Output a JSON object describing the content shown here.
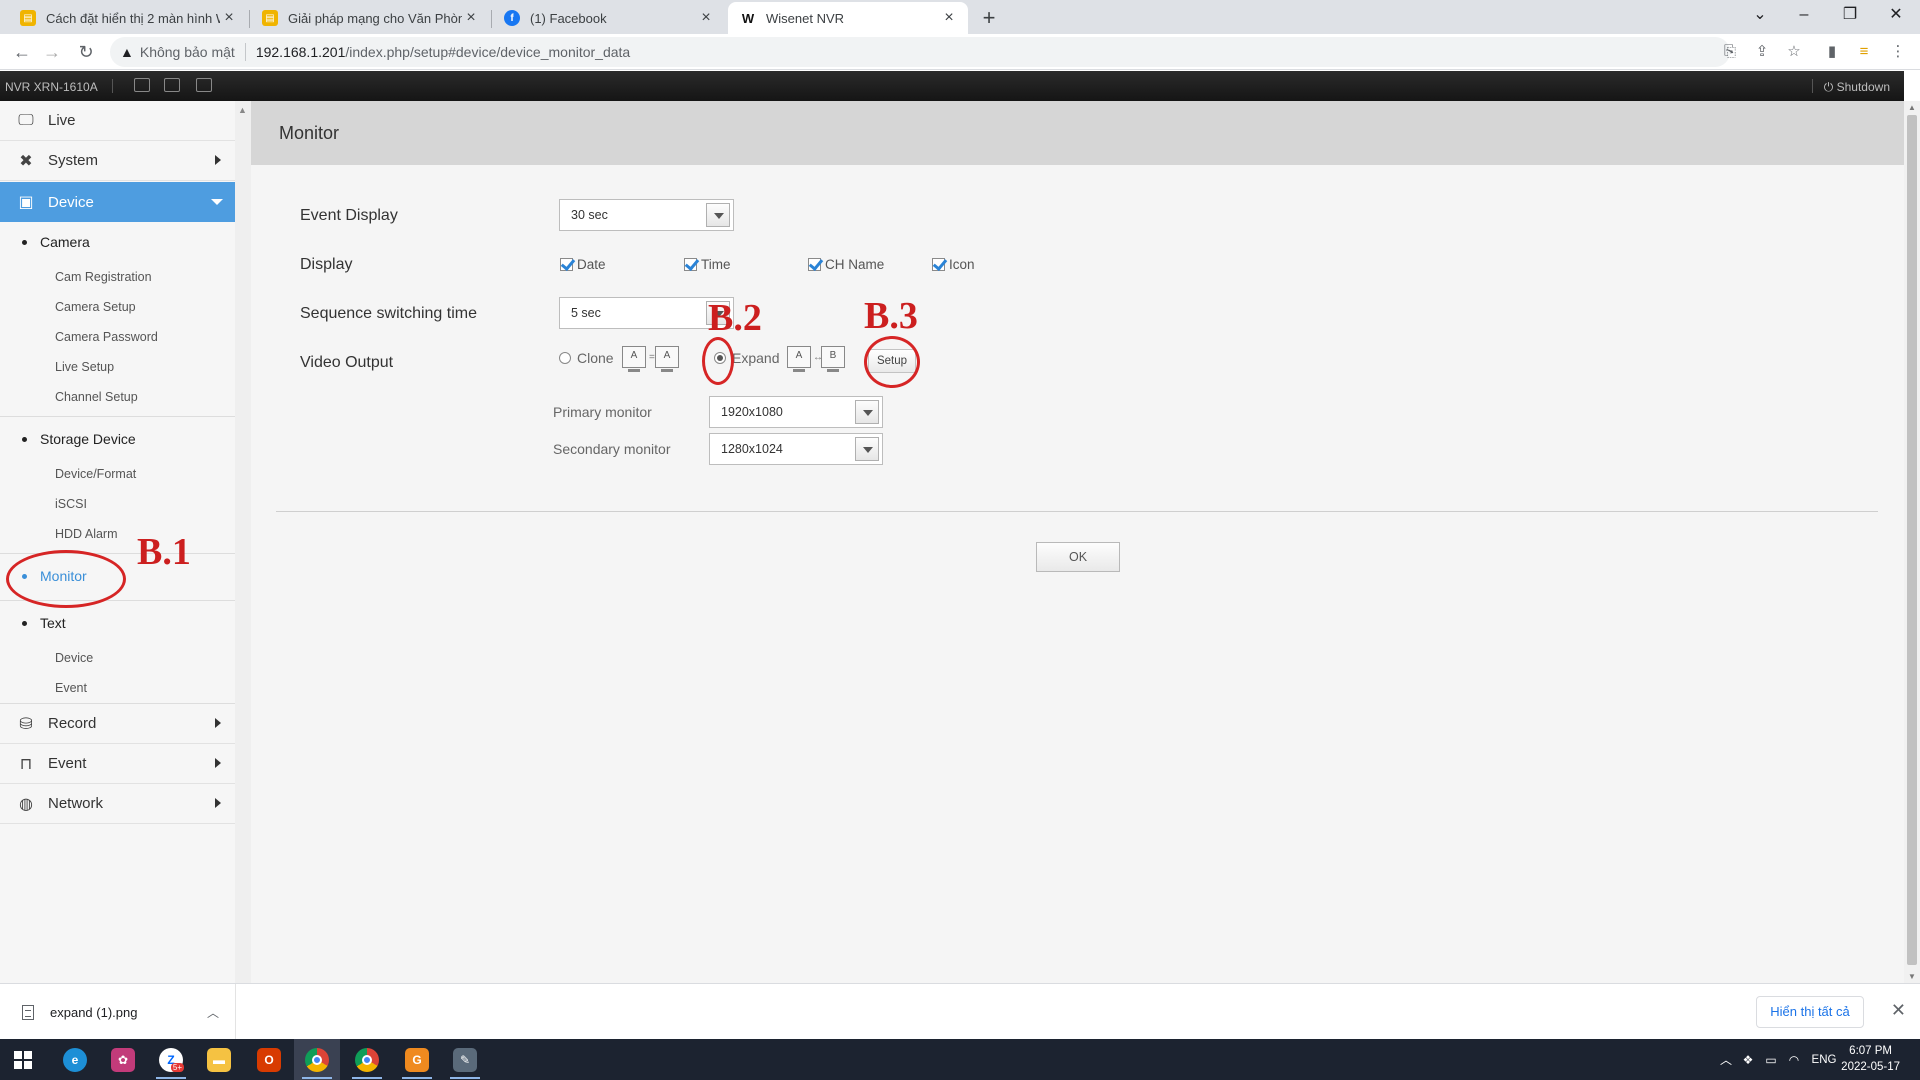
{
  "browser": {
    "tabs": [
      {
        "title": "Cách đặt hiển thị 2 màn hình Wis",
        "favicon": "folder-favicon-icon"
      },
      {
        "title": "Giải pháp mạng cho Văn Phòng,",
        "favicon": "folder-favicon-icon"
      },
      {
        "title": "(1) Facebook",
        "favicon": "facebook-icon"
      },
      {
        "title": "Wisenet NVR",
        "favicon": "wisenet-icon",
        "favicon_text": "W"
      }
    ],
    "address": {
      "security_label": "Không bảo mật",
      "host": "192.168.1.201",
      "path": "/index.php/setup#device/device_monitor_data"
    }
  },
  "nvr": {
    "model": "NVR XRN-1610A",
    "shutdown_label": "Shutdown"
  },
  "sidebar": {
    "menu": [
      {
        "label": "Live",
        "icon": "monitor-icon"
      },
      {
        "label": "System",
        "icon": "tools-icon"
      },
      {
        "label": "Device",
        "icon": "device-icon"
      },
      {
        "label": "Record",
        "icon": "record-icon"
      },
      {
        "label": "Event",
        "icon": "event-icon"
      },
      {
        "label": "Network",
        "icon": "globe-icon"
      }
    ],
    "groups": {
      "camera": {
        "label": "Camera",
        "items": [
          "Cam Registration",
          "Camera Setup",
          "Camera Password",
          "Live Setup",
          "Channel Setup"
        ]
      },
      "storage": {
        "label": "Storage Device",
        "items": [
          "Device/Format",
          "iSCSI",
          "HDD Alarm"
        ]
      },
      "monitor": {
        "label": "Monitor"
      },
      "text": {
        "label": "Text",
        "items": [
          "Device",
          "Event"
        ]
      }
    }
  },
  "page": {
    "title": "Monitor",
    "event_display": {
      "label": "Event Display",
      "value": "30 sec"
    },
    "display": {
      "label": "Display",
      "options": [
        "Date",
        "Time",
        "CH Name",
        "Icon"
      ]
    },
    "sequence": {
      "label": "Sequence switching time",
      "value": "5 sec"
    },
    "video_output": {
      "label": "Video Output",
      "clone_label": "Clone",
      "expand_label": "Expand",
      "setup_label": "Setup",
      "selected": "Expand",
      "clone_icon_letters": [
        "A",
        "A"
      ],
      "expand_icon_letters": [
        "A",
        "B"
      ]
    },
    "primary": {
      "label": "Primary monitor",
      "value": "1920x1080"
    },
    "secondary": {
      "label": "Secondary monitor",
      "value": "1280x1024"
    },
    "ok_label": "OK"
  },
  "annotations": {
    "b1": "B.1",
    "b2": "B.2",
    "b3": "B.3",
    "color": "#cc1f1f"
  },
  "download": {
    "filename": "expand (1).png",
    "show_all": "Hiển thị tất cả"
  },
  "taskbar": {
    "lang": "ENG",
    "time": "6:07 PM",
    "date": "2022-05-17",
    "zalo_badge": "5+"
  }
}
